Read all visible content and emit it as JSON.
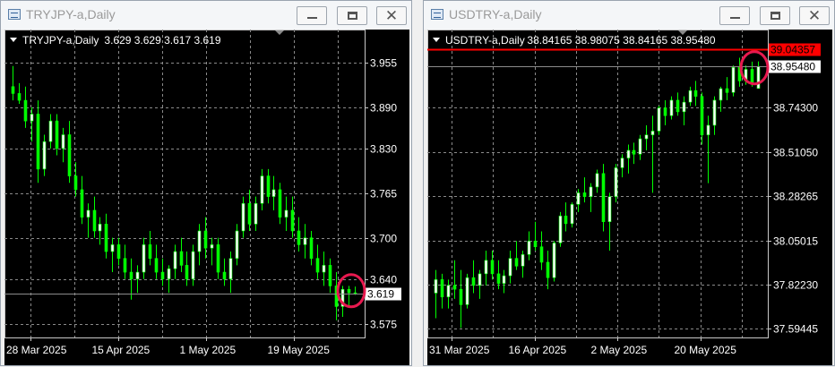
{
  "windows": [
    {
      "title": "TRYJPY-a,Daily",
      "buttons": {
        "minimize": "minimize",
        "maximize": "maximize",
        "close": "close"
      },
      "chart_data": {
        "type": "candlestick",
        "symbol": "TRYJPY-a,Daily",
        "ohlc_header": "3.629 3.629 3.617 3.619",
        "y_ticks": [
          "3.955",
          "3.890",
          "3.830",
          "3.765",
          "3.700",
          "3.640",
          "3.575"
        ],
        "y_tick_values": [
          3.955,
          3.89,
          3.83,
          3.765,
          3.7,
          3.64,
          3.575
        ],
        "x_ticks": [
          "28 Mar 2025",
          "15 Apr 2025",
          "1 May 2025",
          "19 May 2025"
        ],
        "current_price_label": "3.619",
        "current_price": 3.619,
        "ylim": [
          3.555,
          3.99
        ],
        "grid": true,
        "bull_color": "#ffffff",
        "bear_color": "#00ff00",
        "highlight_color": "#e8194f",
        "candles": [
          [
            3.92,
            3.95,
            3.9,
            3.91
          ],
          [
            3.91,
            3.925,
            3.895,
            3.9
          ],
          [
            3.9,
            3.92,
            3.86,
            3.87
          ],
          [
            3.87,
            3.89,
            3.84,
            3.88
          ],
          [
            3.88,
            3.9,
            3.78,
            3.8
          ],
          [
            3.8,
            3.85,
            3.79,
            3.84
          ],
          [
            3.84,
            3.88,
            3.83,
            3.87
          ],
          [
            3.87,
            3.88,
            3.82,
            3.83
          ],
          [
            3.83,
            3.86,
            3.81,
            3.85
          ],
          [
            3.85,
            3.87,
            3.78,
            3.79
          ],
          [
            3.79,
            3.81,
            3.76,
            3.77
          ],
          [
            3.77,
            3.79,
            3.72,
            3.73
          ],
          [
            3.73,
            3.75,
            3.7,
            3.74
          ],
          [
            3.74,
            3.76,
            3.7,
            3.71
          ],
          [
            3.71,
            3.73,
            3.69,
            3.72
          ],
          [
            3.72,
            3.735,
            3.67,
            3.68
          ],
          [
            3.68,
            3.7,
            3.65,
            3.69
          ],
          [
            3.69,
            3.7,
            3.66,
            3.67
          ],
          [
            3.67,
            3.69,
            3.64,
            3.65
          ],
          [
            3.65,
            3.67,
            3.61,
            3.64
          ],
          [
            3.64,
            3.66,
            3.62,
            3.65
          ],
          [
            3.65,
            3.7,
            3.64,
            3.69
          ],
          [
            3.69,
            3.71,
            3.66,
            3.67
          ],
          [
            3.67,
            3.69,
            3.64,
            3.65
          ],
          [
            3.65,
            3.67,
            3.63,
            3.64
          ],
          [
            3.64,
            3.66,
            3.62,
            3.655
          ],
          [
            3.655,
            3.69,
            3.64,
            3.68
          ],
          [
            3.68,
            3.7,
            3.65,
            3.66
          ],
          [
            3.66,
            3.68,
            3.63,
            3.64
          ],
          [
            3.64,
            3.69,
            3.63,
            3.68
          ],
          [
            3.68,
            3.72,
            3.66,
            3.71
          ],
          [
            3.71,
            3.73,
            3.67,
            3.685
          ],
          [
            3.685,
            3.7,
            3.66,
            3.69
          ],
          [
            3.69,
            3.7,
            3.64,
            3.65
          ],
          [
            3.65,
            3.67,
            3.63,
            3.64
          ],
          [
            3.64,
            3.68,
            3.62,
            3.67
          ],
          [
            3.67,
            3.72,
            3.66,
            3.71
          ],
          [
            3.71,
            3.76,
            3.7,
            3.75
          ],
          [
            3.75,
            3.77,
            3.71,
            3.72
          ],
          [
            3.72,
            3.76,
            3.71,
            3.75
          ],
          [
            3.75,
            3.8,
            3.74,
            3.79
          ],
          [
            3.79,
            3.8,
            3.75,
            3.76
          ],
          [
            3.76,
            3.79,
            3.74,
            3.77
          ],
          [
            3.77,
            3.78,
            3.72,
            3.73
          ],
          [
            3.73,
            3.76,
            3.71,
            3.74
          ],
          [
            3.74,
            3.76,
            3.7,
            3.71
          ],
          [
            3.71,
            3.73,
            3.68,
            3.69
          ],
          [
            3.69,
            3.72,
            3.67,
            3.7
          ],
          [
            3.7,
            3.71,
            3.66,
            3.67
          ],
          [
            3.67,
            3.69,
            3.64,
            3.65
          ],
          [
            3.65,
            3.68,
            3.63,
            3.66
          ],
          [
            3.66,
            3.67,
            3.62,
            3.63
          ],
          [
            3.63,
            3.65,
            3.58,
            3.6
          ],
          [
            3.6,
            3.63,
            3.585,
            3.625
          ],
          [
            3.625,
            3.63,
            3.6,
            3.62
          ],
          [
            3.62,
            3.629,
            3.617,
            3.619
          ]
        ]
      }
    },
    {
      "title": "USDTRY-a,Daily",
      "buttons": {
        "minimize": "minimize",
        "maximize": "maximize",
        "close": "close"
      },
      "chart_data": {
        "type": "candlestick",
        "symbol": "USDTRY-a,Daily",
        "ohlc_header": "38.84165 38.98075 38.84165 38.95480",
        "y_ticks": [
          "38.74300",
          "38.51050",
          "38.28265",
          "38.05015",
          "37.82230",
          "37.59445"
        ],
        "y_tick_values": [
          38.743,
          38.5105,
          38.28265,
          38.05015,
          37.8223,
          37.59445
        ],
        "x_ticks": [
          "31 Mar 2025",
          "16 Apr 2025",
          "2 May 2025",
          "20 May 2025"
        ],
        "current_price_label": "38.95480",
        "current_price": 38.9548,
        "ask_label": "39.04357",
        "ask_price": 39.04357,
        "ylim": [
          37.55,
          39.1
        ],
        "grid": true,
        "bull_color": "#ffffff",
        "bear_color": "#00ff00",
        "ask_color": "#ff0000",
        "highlight_color": "#e8194f",
        "candles": [
          [
            37.78,
            37.9,
            37.65,
            37.85
          ],
          [
            37.85,
            37.88,
            37.7,
            37.76
          ],
          [
            37.76,
            37.85,
            37.7,
            37.82
          ],
          [
            37.82,
            37.95,
            37.75,
            37.8
          ],
          [
            37.8,
            37.9,
            37.6,
            37.72
          ],
          [
            37.72,
            37.88,
            37.7,
            37.86
          ],
          [
            37.86,
            37.95,
            37.78,
            37.82
          ],
          [
            37.82,
            37.9,
            37.75,
            37.88
          ],
          [
            37.88,
            38.0,
            37.82,
            37.95
          ],
          [
            37.95,
            38.0,
            37.85,
            37.88
          ],
          [
            37.88,
            37.95,
            37.8,
            37.83
          ],
          [
            37.83,
            37.9,
            37.78,
            37.87
          ],
          [
            37.87,
            38.0,
            37.83,
            37.96
          ],
          [
            37.96,
            38.05,
            37.9,
            37.92
          ],
          [
            37.92,
            38.0,
            37.86,
            37.98
          ],
          [
            37.98,
            38.1,
            37.95,
            38.05
          ],
          [
            38.05,
            38.15,
            38.0,
            38.02
          ],
          [
            38.02,
            38.1,
            37.9,
            37.94
          ],
          [
            37.94,
            38.0,
            37.8,
            37.86
          ],
          [
            37.86,
            38.05,
            37.84,
            38.04
          ],
          [
            38.04,
            38.2,
            38.02,
            38.18
          ],
          [
            38.18,
            38.25,
            38.1,
            38.14
          ],
          [
            38.14,
            38.25,
            38.12,
            38.24
          ],
          [
            38.24,
            38.32,
            38.2,
            38.3
          ],
          [
            38.3,
            38.38,
            38.25,
            38.28
          ],
          [
            38.28,
            38.35,
            38.2,
            38.33
          ],
          [
            38.33,
            38.42,
            38.3,
            38.4
          ],
          [
            38.4,
            38.45,
            38.1,
            38.15
          ],
          [
            38.15,
            38.3,
            38.0,
            38.28
          ],
          [
            38.28,
            38.45,
            38.25,
            38.43
          ],
          [
            38.43,
            38.5,
            38.38,
            38.48
          ],
          [
            38.48,
            38.55,
            38.4,
            38.52
          ],
          [
            38.52,
            38.56,
            38.45,
            38.5
          ],
          [
            38.5,
            38.6,
            38.47,
            38.58
          ],
          [
            38.58,
            38.65,
            38.52,
            38.6
          ],
          [
            38.6,
            38.7,
            38.3,
            38.62
          ],
          [
            38.62,
            38.75,
            38.6,
            38.74
          ],
          [
            38.74,
            38.78,
            38.65,
            38.7
          ],
          [
            38.7,
            38.8,
            38.68,
            38.78
          ],
          [
            38.78,
            38.82,
            38.7,
            38.72
          ],
          [
            38.72,
            38.8,
            38.65,
            38.77
          ],
          [
            38.77,
            38.85,
            38.75,
            38.83
          ],
          [
            38.83,
            38.88,
            38.75,
            38.8
          ],
          [
            38.8,
            38.82,
            38.55,
            38.6
          ],
          [
            38.6,
            38.7,
            38.35,
            38.65
          ],
          [
            38.65,
            38.8,
            38.6,
            38.78
          ],
          [
            38.78,
            38.85,
            38.72,
            38.84
          ],
          [
            38.84,
            38.9,
            38.78,
            38.82
          ],
          [
            38.82,
            38.96,
            38.8,
            38.95
          ],
          [
            38.95,
            39.0,
            38.85,
            38.88
          ],
          [
            38.88,
            38.96,
            38.86,
            38.94
          ],
          [
            38.94,
            38.98,
            38.85,
            38.87
          ],
          [
            38.841,
            38.981,
            38.841,
            38.955
          ]
        ]
      }
    }
  ]
}
